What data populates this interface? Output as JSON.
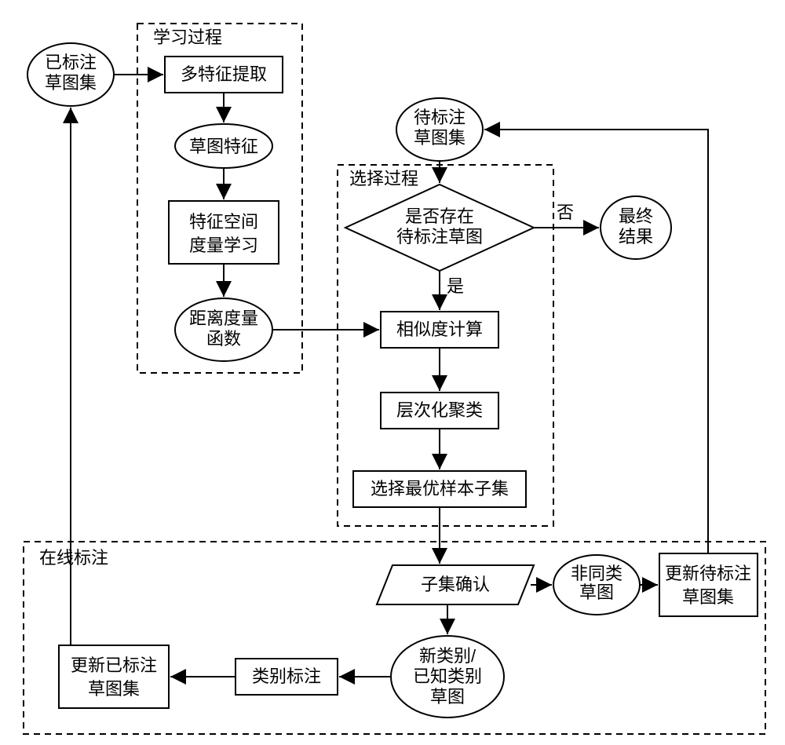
{
  "chart_data": {
    "type": "flowchart",
    "title": "",
    "groups": [
      {
        "name": "学习过程",
        "nodes": [
          "多特征提取",
          "草图特征",
          "特征空间度量学习",
          "距离度量函数"
        ]
      },
      {
        "name": "选择过程",
        "nodes": [
          "是否存在待标注草图",
          "相似度计算",
          "层次化聚类",
          "选择最优样本子集"
        ]
      },
      {
        "name": "在线标注",
        "nodes": [
          "子集确认",
          "非同类草图",
          "更新待标注草图集",
          "新类别/已知类别草图",
          "类别标注",
          "更新已标注草图集"
        ]
      }
    ],
    "entry_nodes": [
      "已标注草图集",
      "待标注草图集"
    ],
    "terminals": [
      "最终结果"
    ],
    "decision_labels": {
      "yes": "是",
      "no": "否"
    },
    "edges": [
      [
        "已标注草图集",
        "多特征提取"
      ],
      [
        "多特征提取",
        "草图特征"
      ],
      [
        "草图特征",
        "特征空间度量学习"
      ],
      [
        "特征空间度量学习",
        "距离度量函数"
      ],
      [
        "待标注草图集",
        "是否存在待标注草图"
      ],
      [
        "是否存在待标注草图",
        "最终结果",
        "否"
      ],
      [
        "是否存在待标注草图",
        "相似度计算",
        "是"
      ],
      [
        "距离度量函数",
        "相似度计算"
      ],
      [
        "相似度计算",
        "层次化聚类"
      ],
      [
        "层次化聚类",
        "选择最优样本子集"
      ],
      [
        "选择最优样本子集",
        "子集确认"
      ],
      [
        "子集确认",
        "非同类草图"
      ],
      [
        "非同类草图",
        "更新待标注草图集"
      ],
      [
        "更新待标注草图集",
        "待标注草图集"
      ],
      [
        "子集确认",
        "新类别/已知类别草图"
      ],
      [
        "新类别/已知类别草图",
        "类别标注"
      ],
      [
        "类别标注",
        "更新已标注草图集"
      ],
      [
        "更新已标注草图集",
        "已标注草图集"
      ]
    ]
  },
  "nodes": {
    "labeled_set_l1": "已标注",
    "labeled_set_l2": "草图集",
    "grp_learn": "学习过程",
    "feat_extract": "多特征提取",
    "sketch_feat": "草图特征",
    "space_learn_l1": "特征空间",
    "space_learn_l2": "度量学习",
    "dist_fn_l1": "距离度量",
    "dist_fn_l2": "函数",
    "unlabeled_l1": "待标注",
    "unlabeled_l2": "草图集",
    "grp_select": "选择过程",
    "has_unlabeled_l1": "是否存在",
    "has_unlabeled_l2": "待标注草图",
    "no": "否",
    "yes": "是",
    "final_l1": "最终",
    "final_l2": "结果",
    "similarity": "相似度计算",
    "cluster": "层次化聚类",
    "best_subset": "选择最优样本子集",
    "grp_online": "在线标注",
    "confirm_subset": "子集确认",
    "nonclass_l1": "非同类",
    "nonclass_l2": "草图",
    "update_unlabeled_l1": "更新待标注",
    "update_unlabeled_l2": "草图集",
    "newclass_l1": "新类别/",
    "newclass_l2": "已知类别",
    "newclass_l3": "草图",
    "class_label": "类别标注",
    "update_labeled_l1": "更新已标注",
    "update_labeled_l2": "草图集"
  }
}
